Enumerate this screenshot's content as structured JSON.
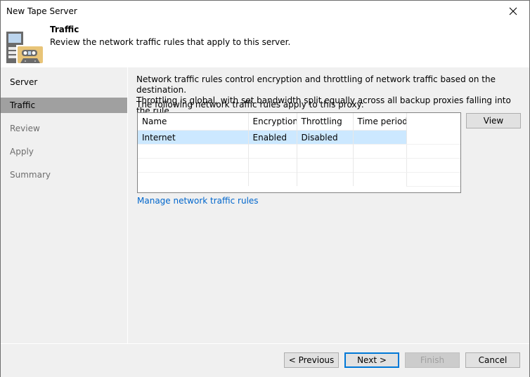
{
  "window": {
    "title": "New Tape Server",
    "close_icon": "close-icon"
  },
  "header": {
    "icon": "tape-server-icon",
    "title": "Traffic",
    "subtitle": "Review the network traffic rules that apply to this server."
  },
  "nav": {
    "items": [
      {
        "label": "Server",
        "state": "normal"
      },
      {
        "label": "Traffic",
        "state": "active"
      },
      {
        "label": "Review",
        "state": "disabled"
      },
      {
        "label": "Apply",
        "state": "disabled"
      },
      {
        "label": "Summary",
        "state": "disabled"
      }
    ]
  },
  "content": {
    "description_line1": "Network traffic rules control encryption and throttling of network traffic based on the destination.",
    "description_line2": "Throttling is global, with set bandwidth split equally across all backup proxies falling into the rule.",
    "table_label": "The following network traffic rules apply to this proxy:",
    "table": {
      "columns": [
        "Name",
        "Encryption",
        "Throttling",
        "Time period"
      ],
      "rows": [
        {
          "name": "Internet",
          "encryption": "Enabled",
          "throttling": "Disabled",
          "time_period": "",
          "selected": true
        }
      ]
    },
    "view_button": "View",
    "manage_link": "Manage network traffic rules"
  },
  "footer": {
    "previous": "< Previous",
    "next": "Next >",
    "finish": "Finish",
    "cancel": "Cancel"
  },
  "colors": {
    "selection": "#cce8ff",
    "nav_active": "#a0a0a0",
    "link": "#0066cc",
    "default_button_border": "#0078d7"
  }
}
